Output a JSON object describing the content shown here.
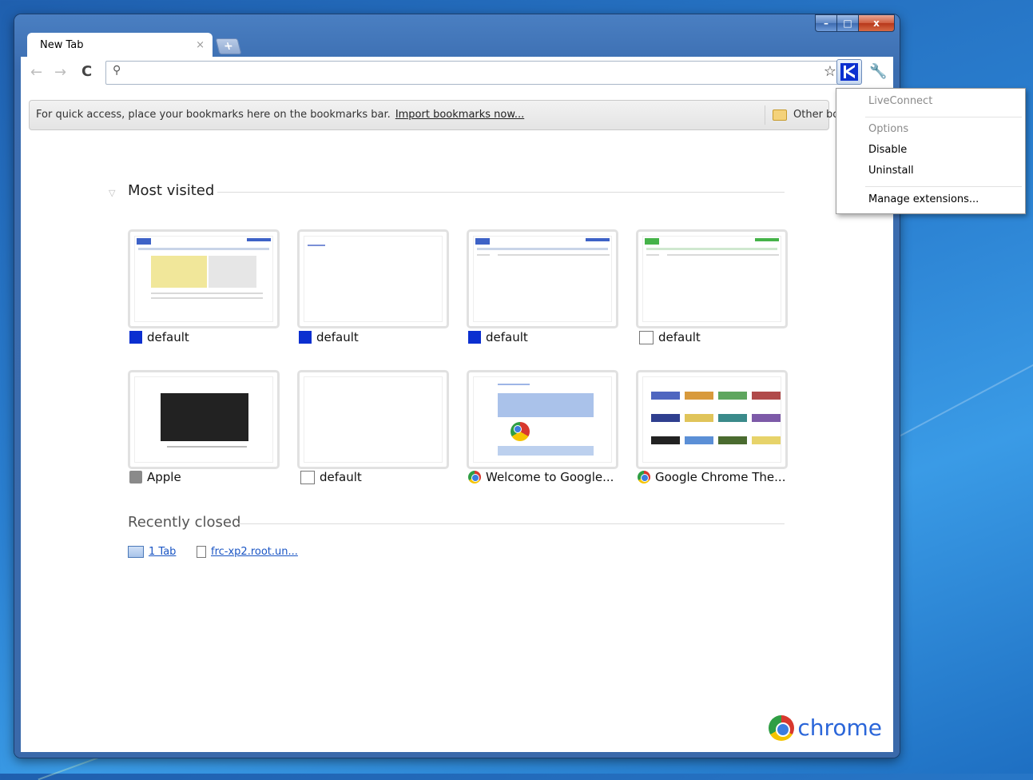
{
  "window": {
    "tab_title": "New Tab",
    "tab_close": "×",
    "new_tab": "+",
    "caption": {
      "minimize": "–",
      "maximize": "□",
      "close": "x"
    }
  },
  "toolbar": {
    "back": "←",
    "forward": "→",
    "reload": "C",
    "search_glyph": "⚲",
    "url_value": "",
    "star": "☆",
    "wrench": "🔧"
  },
  "bookmarks_bar": {
    "message": "For quick access, place your bookmarks here on the bookmarks bar.",
    "import_link": "Import bookmarks now...",
    "other_label": "Other bo"
  },
  "most_visited": {
    "title": "Most visited",
    "tiles": [
      {
        "label": "default",
        "icon": "k-icon"
      },
      {
        "label": "default",
        "icon": "k-icon"
      },
      {
        "label": "default",
        "icon": "k-icon"
      },
      {
        "label": "default",
        "icon": "page-icon"
      },
      {
        "label": "Apple",
        "icon": "apple-icon"
      },
      {
        "label": "default",
        "icon": "page-icon"
      },
      {
        "label": "Welcome to Google...",
        "icon": "chrome-icon"
      },
      {
        "label": "Google Chrome The...",
        "icon": "chrome-icon"
      }
    ]
  },
  "recently_closed": {
    "title": "Recently closed",
    "items": [
      {
        "label": "1 Tab",
        "icon": "tab-icon"
      },
      {
        "label": "frc-xp2.root.un...",
        "icon": "page-icon"
      }
    ]
  },
  "brand": {
    "word": "chrome"
  },
  "extension_menu": {
    "title": "LiveConnect",
    "items": [
      "Options",
      "Disable",
      "Uninstall",
      "Manage extensions..."
    ]
  },
  "colors": {
    "accent": "#0b2fd0",
    "link": "#1a55c4"
  }
}
